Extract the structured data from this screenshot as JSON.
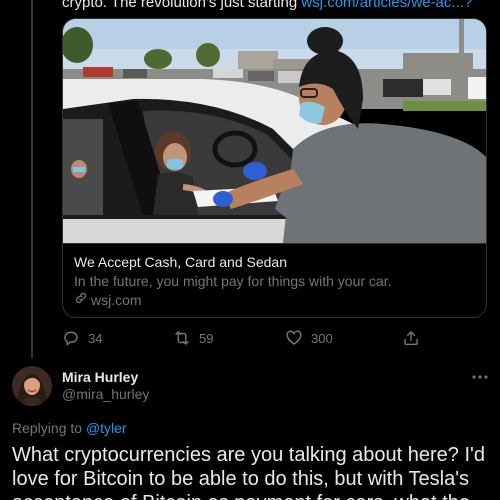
{
  "tweet": {
    "truncated_text": "crypto. The revolution's just starting ",
    "link_text": "wsj.com/articles/we-ac...?",
    "card": {
      "title": "We Accept Cash, Card and Sedan",
      "description": "In the future, you might pay for things with your car.",
      "domain": "wsj.com",
      "image_icon": "photo-person-paying-from-car-window"
    },
    "actions": {
      "reply_count": "34",
      "retweet_count": "59",
      "like_count": "300",
      "reply_icon": "reply-icon",
      "retweet_icon": "retweet-icon",
      "like_icon": "heart-icon",
      "share_icon": "share-icon"
    }
  },
  "reply": {
    "display_name": "Mira Hurley",
    "handle": "@mira_hurley",
    "replying_prefix": "Replying to ",
    "replying_to": "@tyler",
    "body_line1": "What cryptocurrencies are you talking about here? I'd",
    "body_line2": "love for Bitcoin to be able to do this, but with Tesla's",
    "body_line3": "acceptance of Bitcoin as payment for cars, what the"
  },
  "colors": {
    "background": "#000000",
    "text": "#e7e9ea",
    "muted": "#71767b",
    "accent": "#1d9bf0",
    "border": "#2f3336"
  }
}
